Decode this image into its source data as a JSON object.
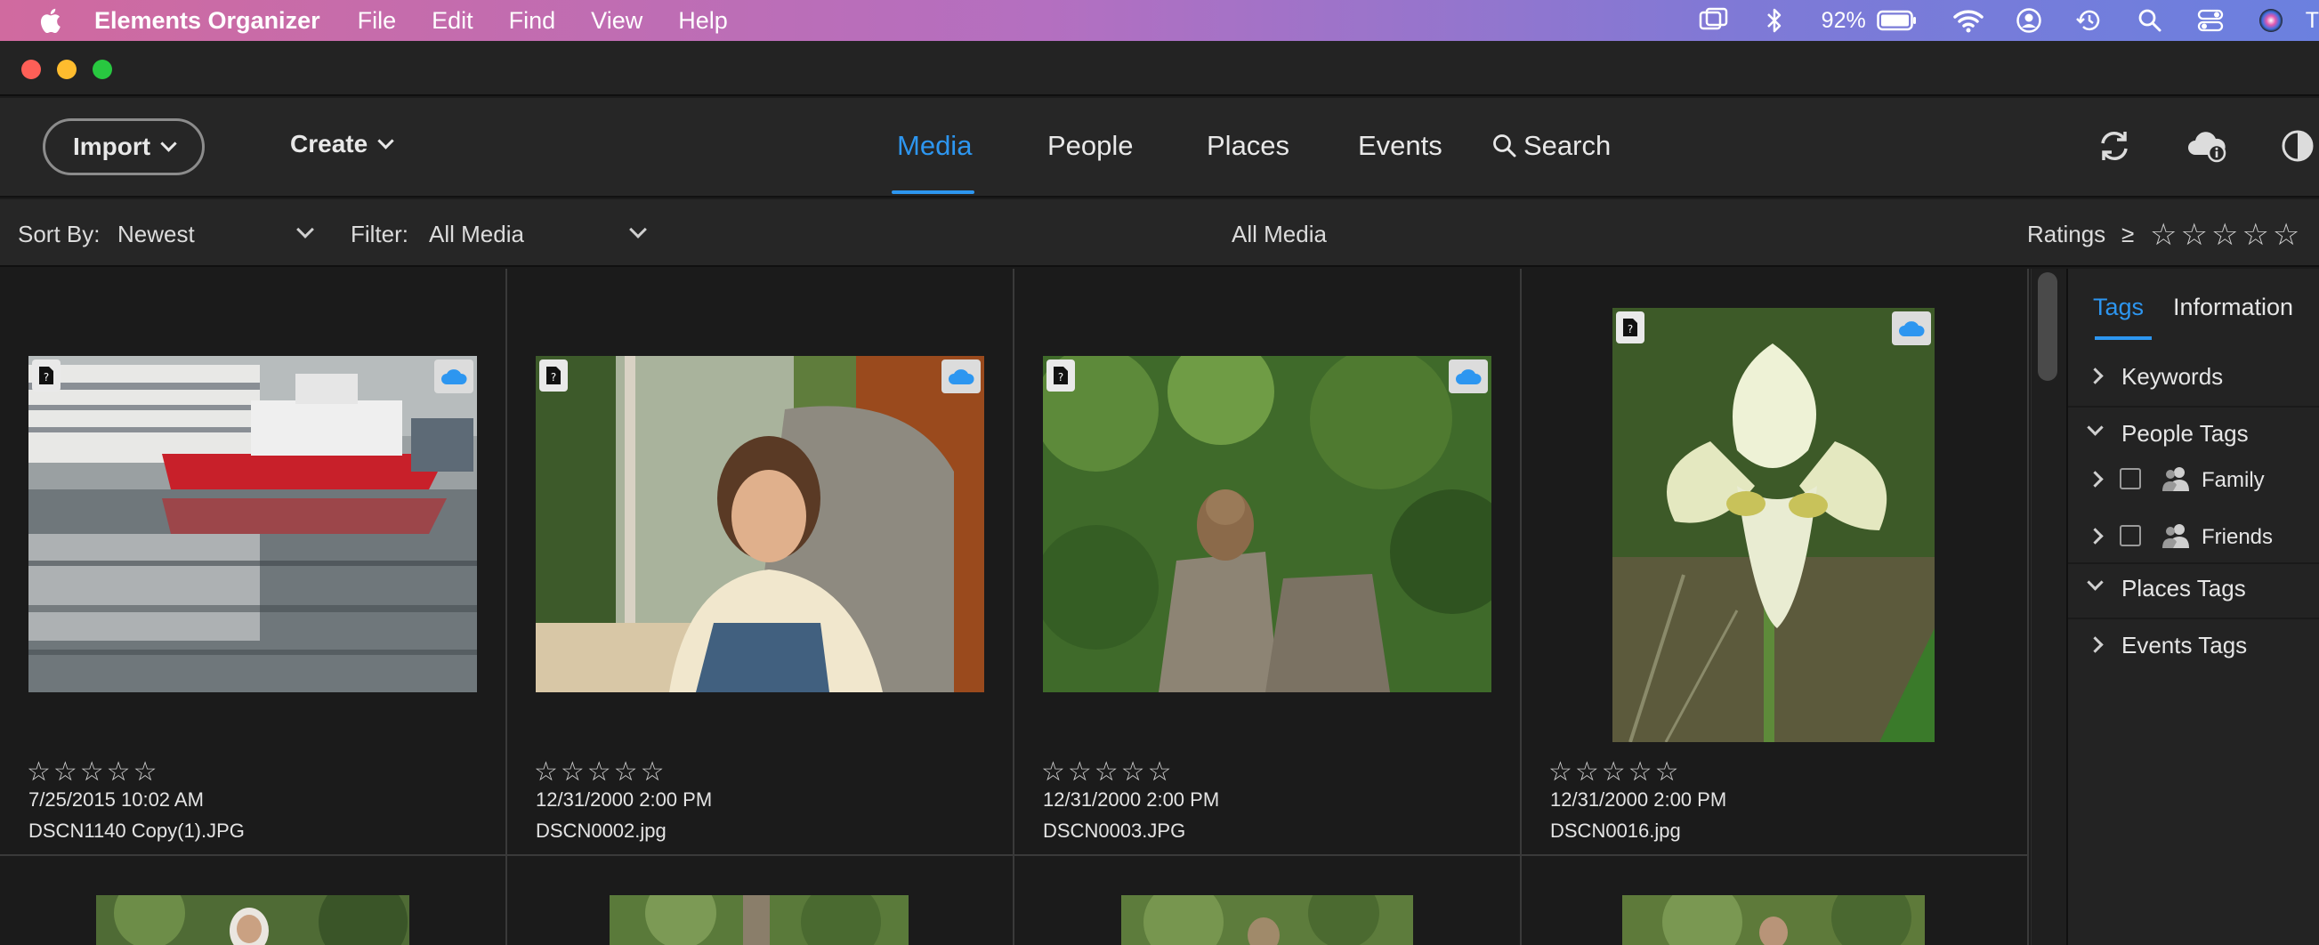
{
  "menubar": {
    "app": "Elements Organizer",
    "items": [
      "File",
      "Edit",
      "Find",
      "View",
      "Help"
    ],
    "battery": "92%",
    "trailing": "T"
  },
  "toolbar": {
    "import_label": "Import",
    "create_label": "Create",
    "tabs": [
      "Media",
      "People",
      "Places",
      "Events",
      "Search"
    ],
    "active_tab": "Media"
  },
  "filterbar": {
    "sort_label": "Sort By:",
    "sort_value": "Newest",
    "filter_label": "Filter:",
    "filter_value": "All Media",
    "center_title": "All Media",
    "ratings_label": "Ratings",
    "ratings_op": "≥",
    "ratings_stars": "☆☆☆☆☆"
  },
  "media": [
    {
      "stars": "☆☆☆☆☆",
      "date": "7/25/2015 10:02 AM",
      "name": "DSCN1140 Copy(1).JPG",
      "subject": "ship-harbor-photo"
    },
    {
      "stars": "☆☆☆☆☆",
      "date": "12/31/2000 2:00 PM",
      "name": "DSCN0002.jpg",
      "subject": "girl-in-chair-photo"
    },
    {
      "stars": "☆☆☆☆☆",
      "date": "12/31/2000 2:00 PM",
      "name": "DSCN0003.JPG",
      "subject": "chipmunk-on-stump-photo"
    },
    {
      "stars": "☆☆☆☆☆",
      "date": "12/31/2000 2:00 PM",
      "name": "DSCN0016.jpg",
      "subject": "iris-flower-photo"
    }
  ],
  "panel": {
    "tabs": [
      "Tags",
      "Information"
    ],
    "active_tab": "Tags",
    "keywords": "Keywords",
    "people_tags": "People Tags",
    "family": "Family",
    "friends": "Friends",
    "places_tags": "Places Tags",
    "events_tags": "Events Tags"
  },
  "colors": {
    "accent": "#2d96f0",
    "cloud": "#2d96f0"
  }
}
